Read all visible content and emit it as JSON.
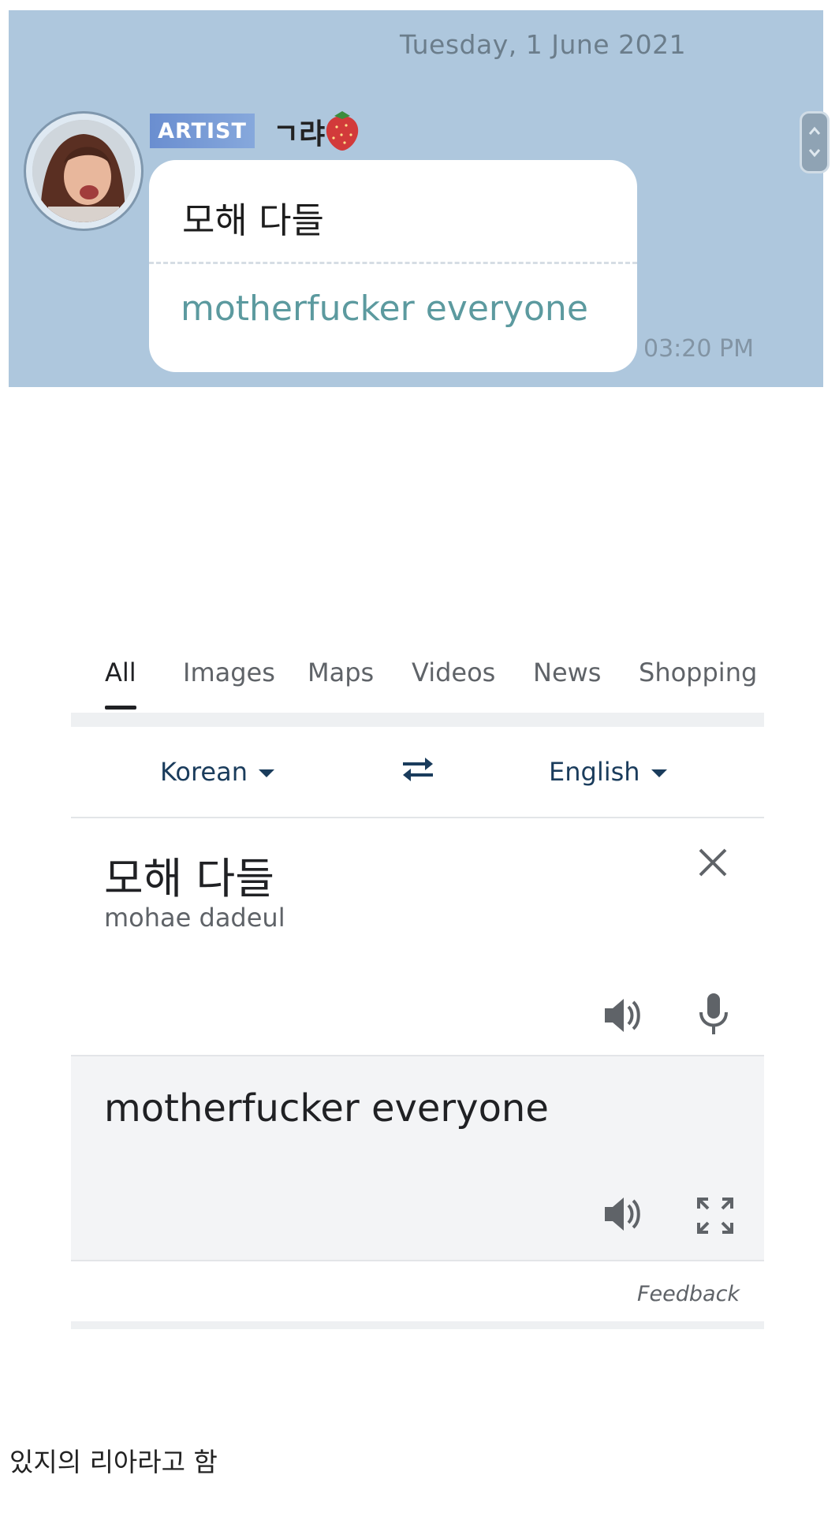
{
  "chat": {
    "date": "Tuesday, 1 June 2021",
    "badge": "ARTIST",
    "sender": "ㄱ랴",
    "message_korean": "모해 다들",
    "message_translation": "motherfucker everyone",
    "time": "03:20 PM"
  },
  "search_tabs": [
    "All",
    "Images",
    "Maps",
    "Videos",
    "News",
    "Shopping"
  ],
  "translator": {
    "source_language": "Korean",
    "target_language": "English",
    "source_text": "모해 다들",
    "transliteration": "mohae dadeul",
    "result_text": "motherfucker everyone",
    "feedback_label": "Feedback"
  },
  "caption": "있지의 리아라고 함",
  "colors": {
    "chat_background": "#aec7dd",
    "badge": "#7699d4",
    "translation_text": "#5c9a9f",
    "language_text": "#1a3c5c"
  }
}
